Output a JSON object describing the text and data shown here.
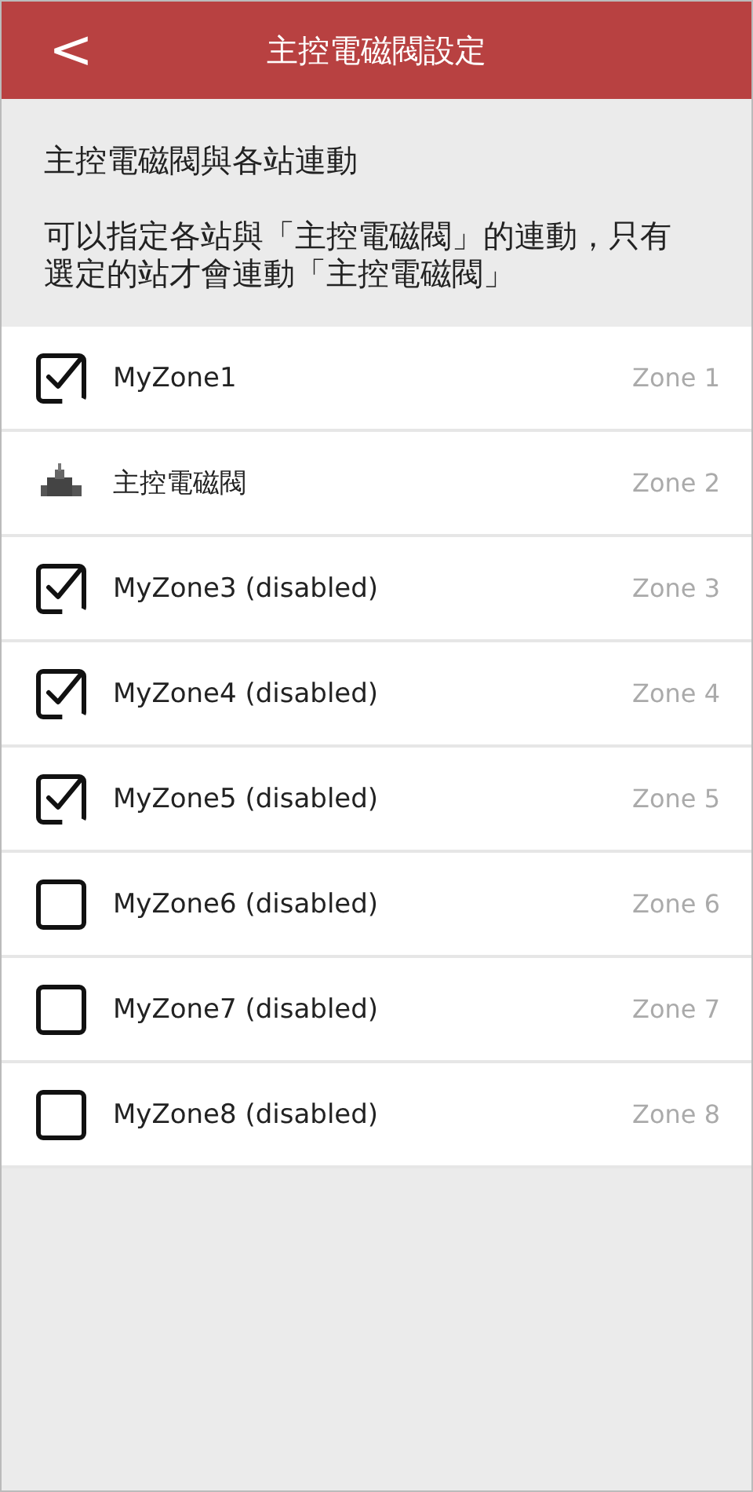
{
  "header": {
    "back": "<",
    "title": "主控電磁閥設定"
  },
  "intro": {
    "heading": "主控電磁閥與各站連動",
    "description": "可以指定各站與「主控電磁閥」的連動，只有選定的站才會連動「主控電磁閥」"
  },
  "zones": [
    {
      "kind": "checkbox",
      "checked": true,
      "name": "MyZone1",
      "zone": "Zone 1"
    },
    {
      "kind": "valve",
      "name": "主控電磁閥",
      "zone": "Zone 2"
    },
    {
      "kind": "checkbox",
      "checked": true,
      "name": "MyZone3 (disabled)",
      "zone": "Zone 3"
    },
    {
      "kind": "checkbox",
      "checked": true,
      "name": "MyZone4 (disabled)",
      "zone": "Zone 4"
    },
    {
      "kind": "checkbox",
      "checked": true,
      "name": "MyZone5 (disabled)",
      "zone": "Zone 5"
    },
    {
      "kind": "checkbox",
      "checked": false,
      "name": "MyZone6 (disabled)",
      "zone": "Zone 6"
    },
    {
      "kind": "checkbox",
      "checked": false,
      "name": "MyZone7 (disabled)",
      "zone": "Zone 7"
    },
    {
      "kind": "checkbox",
      "checked": false,
      "name": "MyZone8 (disabled)",
      "zone": "Zone 8"
    }
  ]
}
